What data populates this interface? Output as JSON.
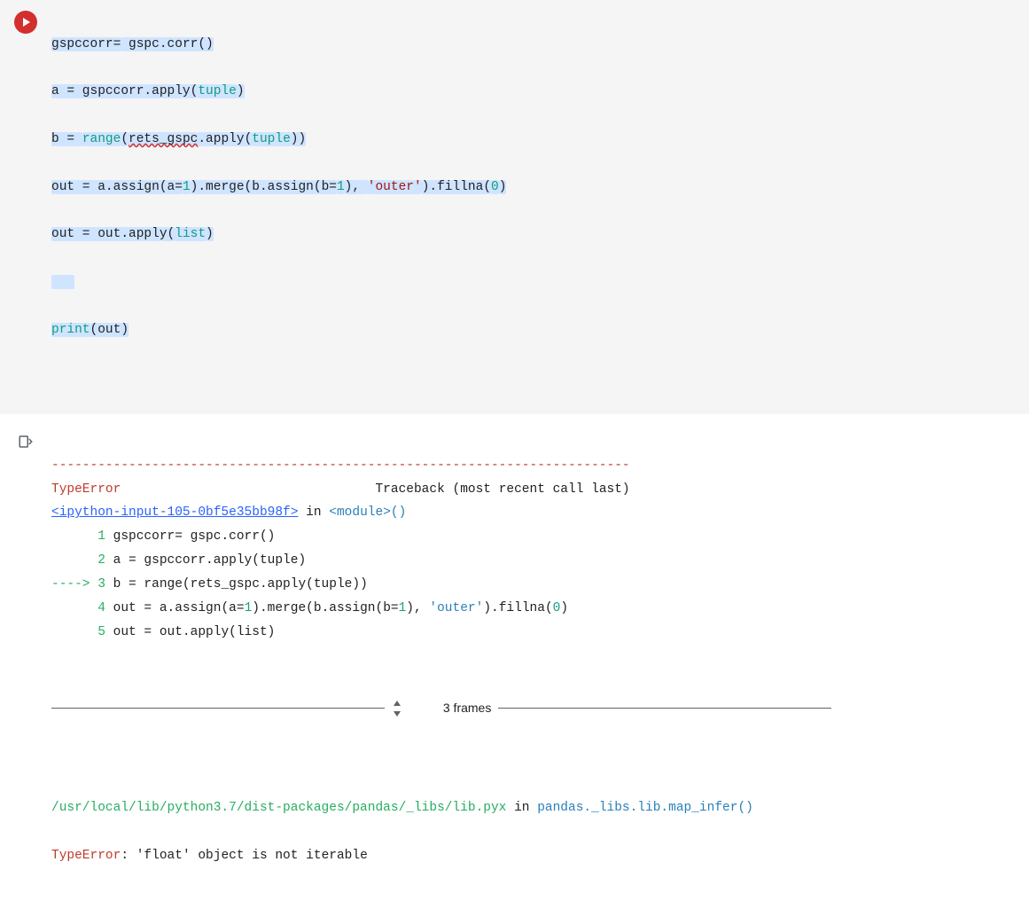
{
  "code": {
    "lines": [
      {
        "prefix": "",
        "t1": "gspccorr=",
        "t2": " gspc.corr()",
        "hl": true
      },
      {
        "prefix": "",
        "t1": "a = gspccorr.apply(",
        "kw": "tuple",
        "t2": ")",
        "hl": true
      },
      {
        "prefix": "",
        "t1": "b = ",
        "fn": "range",
        "mid": "(",
        "sq": "rets_gspc",
        "t2": ".apply(",
        "kw": "tuple",
        "t3": "))",
        "hl": true
      },
      {
        "prefix": "",
        "t1": "out = a.assign(a=",
        "num1": "1",
        "t2": ").merge(b.assign(b=",
        "num2": "1",
        "t3": "), ",
        "str": "'outer'",
        "t4": ").fillna(",
        "num3": "0",
        "t5": ")",
        "hl": true
      },
      {
        "prefix": "",
        "t1": "out = out.apply(",
        "kw": "list",
        "t2": ")",
        "hl": true
      },
      {
        "prefix": "",
        "t1": "",
        "blank_hl": true
      },
      {
        "prefix": "",
        "fn": "print",
        "t1": "(out)",
        "hl": true
      }
    ]
  },
  "output": {
    "dashrow": "---------------------------------------------------------------------------",
    "err_name": "TypeError",
    "err_trace": "                                 Traceback (most recent call last)",
    "ipy_link": "<ipython-input-105-0bf5e35bb98f>",
    "in_word": " in ",
    "module": "<module>",
    "paren": "()",
    "lines": [
      {
        "prefix": "      ",
        "num": "1",
        "code": " gspccorr= gspc.corr()"
      },
      {
        "prefix": "      ",
        "num": "2",
        "code": " a = gspccorr.apply(tuple)"
      },
      {
        "arrow": "----> ",
        "num": "3",
        "code": " b = range(rets_gspc.apply(tuple))"
      },
      {
        "prefix": "      ",
        "num": "4",
        "code_pre": " out = a.assign(a=",
        "num1": "1",
        "mid1": ").merge(b.assign(b=",
        "num2": "1",
        "mid2": "), ",
        "str": "'outer'",
        "mid3": ").fillna(",
        "num3": "0",
        "end": ")"
      },
      {
        "prefix": "      ",
        "num": "5",
        "code": " out = out.apply(list)"
      }
    ],
    "frames": "3 frames",
    "path": "/usr/local/lib/python3.7/dist-packages/pandas/_libs/lib.pyx",
    "in_word2": " in ",
    "func": "pandas._libs.lib.map_infer",
    "func_paren": "()",
    "final_err": "TypeError",
    "final_msg": ": 'float' object is not iterable"
  }
}
